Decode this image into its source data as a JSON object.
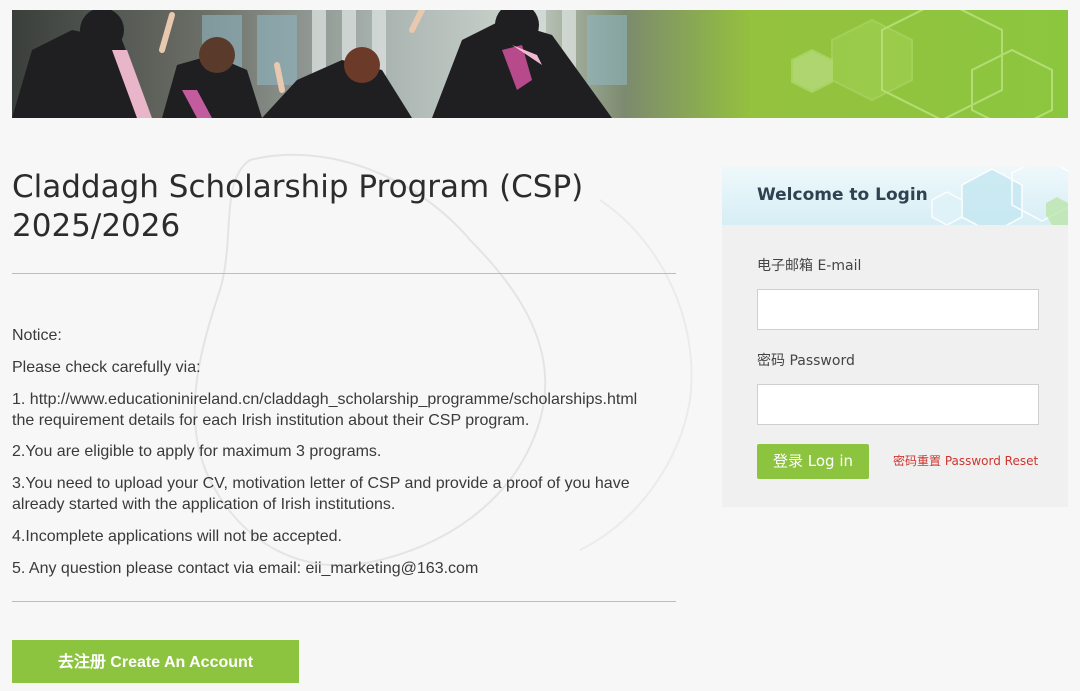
{
  "page": {
    "title": "Claddagh Scholarship Program (CSP) 2025/2026"
  },
  "notice": {
    "heading": "Notice:",
    "intro": "Please check carefully via:",
    "item1_url": "1. http://www.educationinireland.cn/claddagh_scholarship_programme/scholarships.html",
    "item1_text": "the requirement details for each Irish institution about their CSP program.",
    "item2": "2.You are eligible to apply for maximum 3 programs.",
    "item3_line1": "3.You need to upload your CV, motivation letter of CSP and provide a proof of you have",
    "item3_line2": "already started with the application of Irish institutions.",
    "item4": "4.Incomplete applications will not be accepted.",
    "item5": "5. Any question please contact via email: eii_marketing@163.com"
  },
  "create_account": {
    "label": "去注册 Create An Account"
  },
  "login": {
    "title": "Welcome to Login",
    "email_label": "电子邮箱 E-mail",
    "email_value": "",
    "password_label": "密码 Password",
    "password_value": "",
    "login_button": "登录 Log in",
    "reset_link": "密码重置 Password Reset"
  },
  "colors": {
    "accent_green": "#8dc43f",
    "reset_red": "#d0352e",
    "login_head": "#d6eef5"
  },
  "icons": [
    "graduation-banner-image",
    "hexagon-decoration"
  ]
}
